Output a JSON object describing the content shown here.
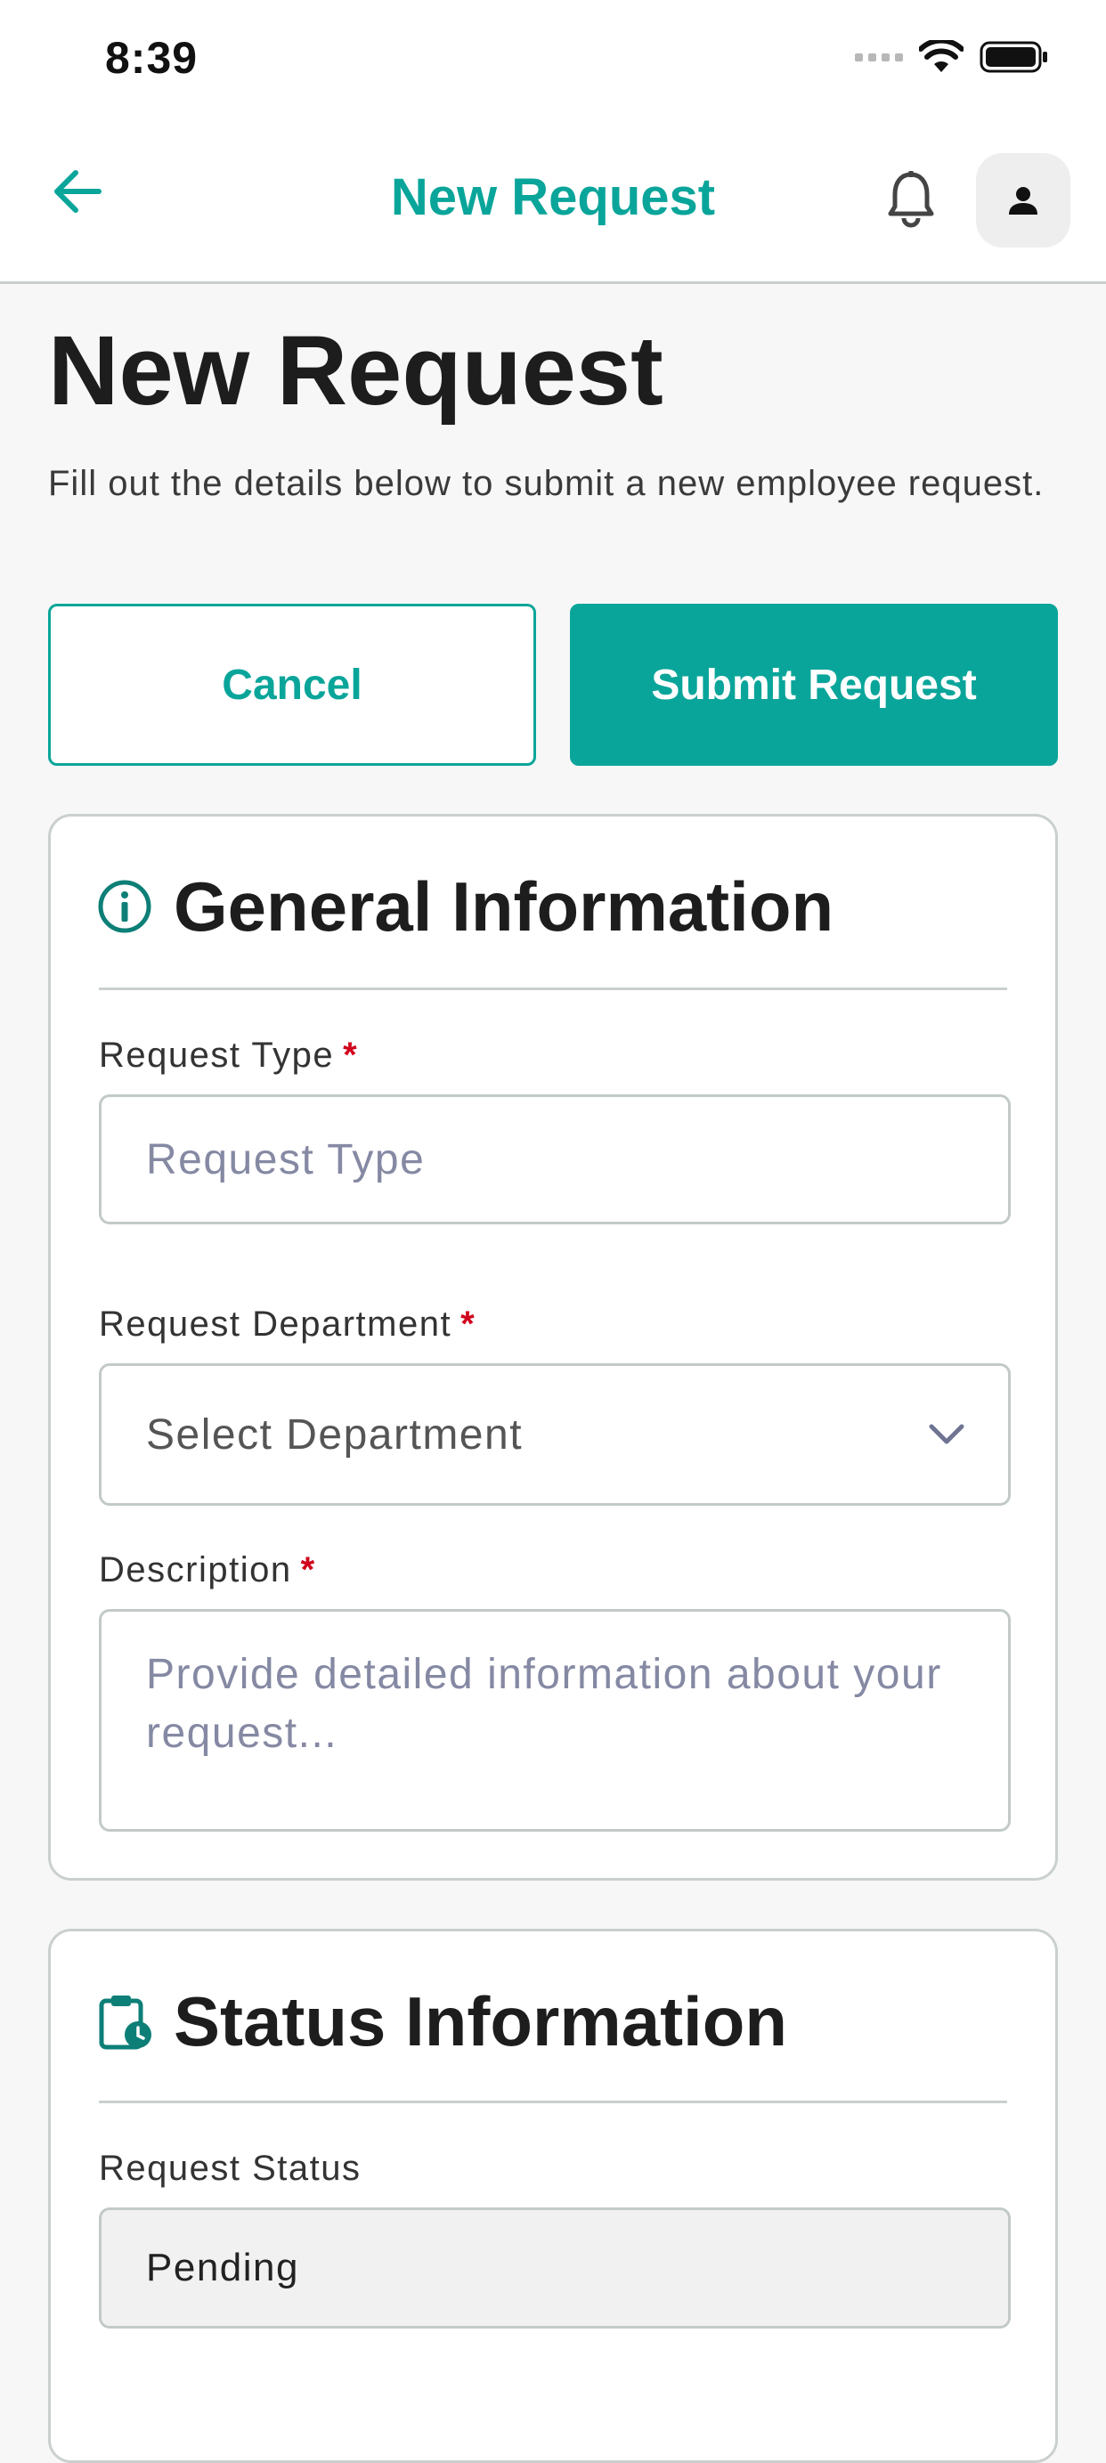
{
  "status_bar": {
    "time": "8:39"
  },
  "header": {
    "title": "New Request"
  },
  "page": {
    "title": "New Request",
    "subtitle": "Fill out the details below to submit a new employee request."
  },
  "actions": {
    "cancel_label": "Cancel",
    "submit_label": "Submit Request"
  },
  "general_info": {
    "title": "General Information",
    "request_type": {
      "label": "Request Type",
      "required_mark": "*",
      "placeholder": "Request Type"
    },
    "department": {
      "label": "Request Department",
      "required_mark": "*",
      "selected": "Select Department"
    },
    "description": {
      "label": "Description",
      "required_mark": "*",
      "placeholder": "Provide detailed information about your request..."
    }
  },
  "status_info": {
    "title": "Status Information",
    "request_status": {
      "label": "Request Status",
      "value": "Pending"
    }
  },
  "colors": {
    "accent": "#0aa59a",
    "required": "#d0021b",
    "border": "#c9d0ce",
    "background": "#f7f7f7"
  },
  "icons": {
    "back": "arrow-left-icon",
    "bell": "bell-icon",
    "avatar": "person-icon",
    "info": "info-circle-icon",
    "chevron": "chevron-down-icon",
    "status": "clipboard-clock-icon"
  }
}
